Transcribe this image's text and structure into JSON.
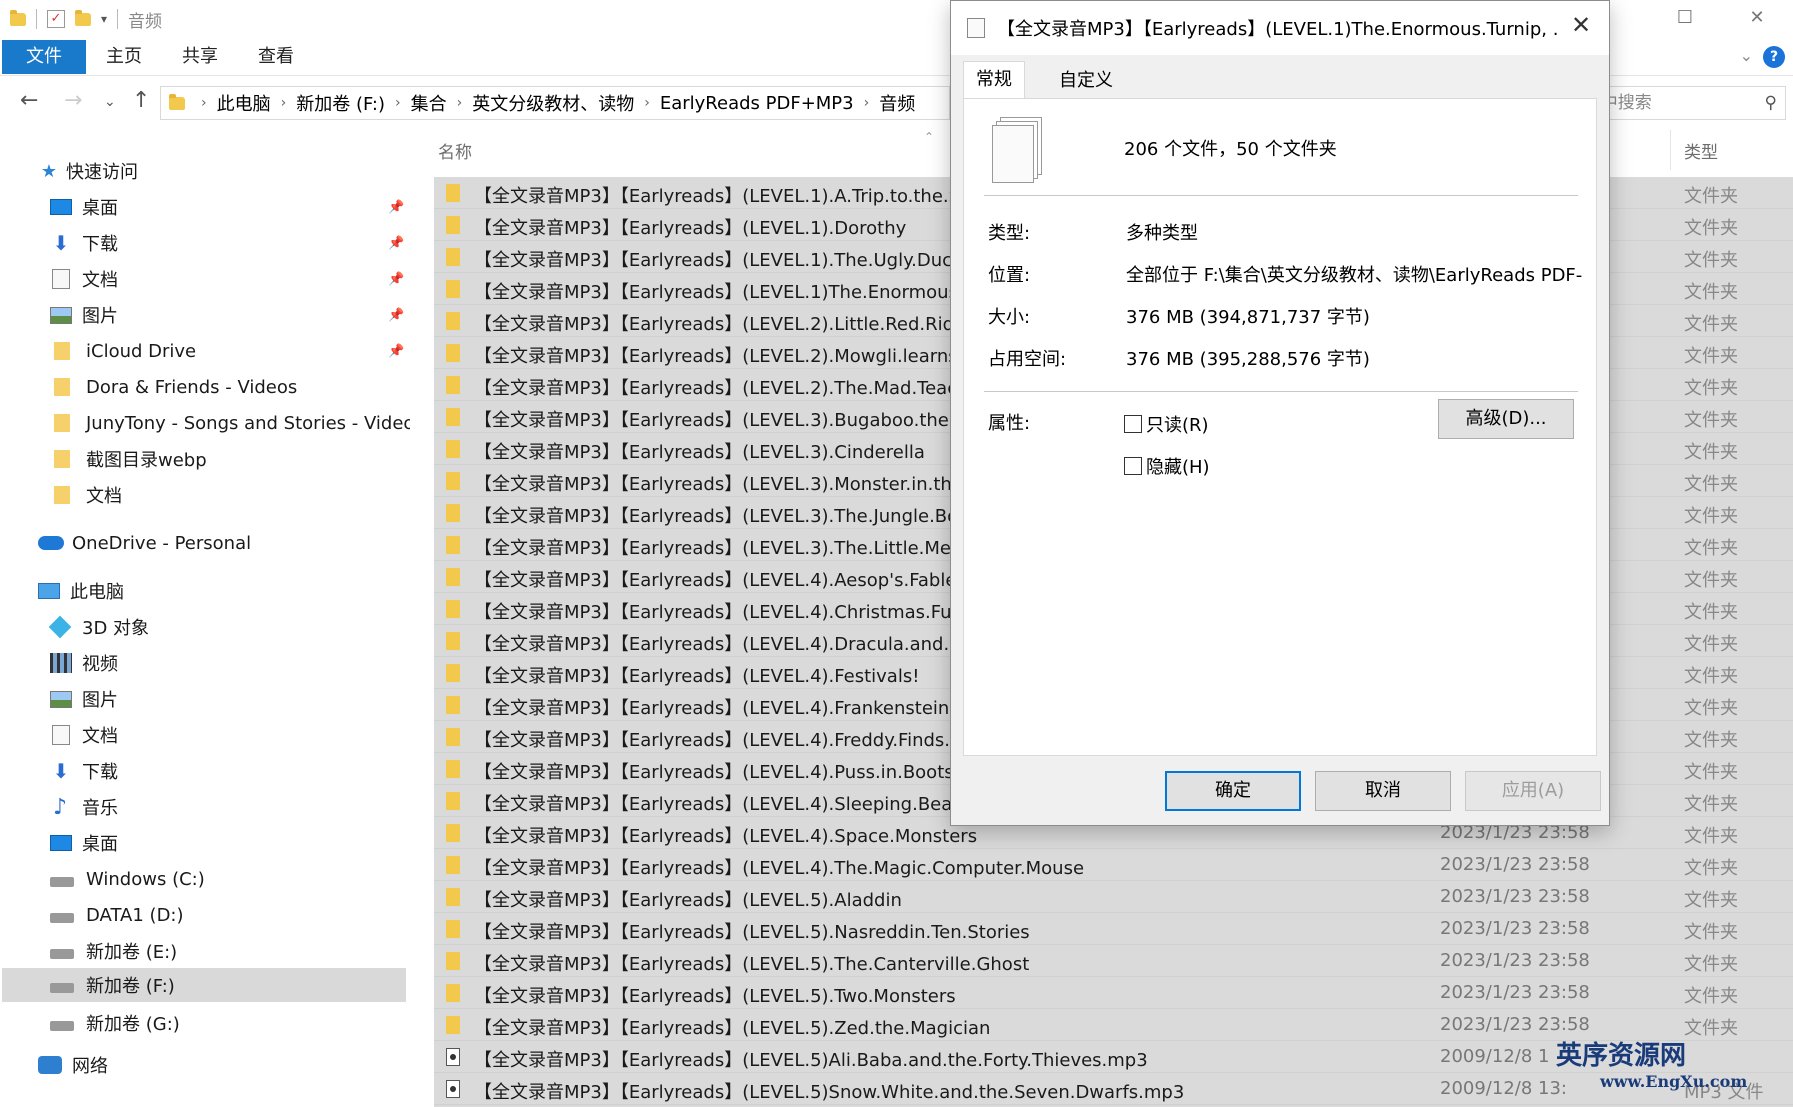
{
  "titlebar": {
    "title": "音频"
  },
  "ribbon": {
    "tabs": [
      "文件",
      "主页",
      "共享",
      "查看"
    ],
    "help": "?"
  },
  "address": {
    "crumbs": [
      "此电脑",
      "新加卷 (F:)",
      "集合",
      "英文分级教材、读物",
      "EarlyReads PDF+MP3",
      "音频"
    ],
    "search_placeholder": "在 音频 中搜索"
  },
  "nav": {
    "quick_access": "快速访问",
    "items": [
      {
        "label": "桌面"
      },
      {
        "label": "下载"
      },
      {
        "label": "文档"
      },
      {
        "label": "图片"
      },
      {
        "label": "iCloud Drive"
      },
      {
        "label": "Dora & Friends - Videos"
      },
      {
        "label": "JunyTony - Songs and Stories - Videos"
      },
      {
        "label": "截图目录webp"
      },
      {
        "label": "文档"
      }
    ],
    "onedrive": "OneDrive - Personal",
    "this_pc": "此电脑",
    "pc_items": [
      {
        "label": "3D 对象"
      },
      {
        "label": "视频"
      },
      {
        "label": "图片"
      },
      {
        "label": "文档"
      },
      {
        "label": "下载"
      },
      {
        "label": "音乐"
      },
      {
        "label": "桌面"
      },
      {
        "label": "Windows (C:)"
      },
      {
        "label": "DATA1 (D:)"
      },
      {
        "label": "新加卷 (E:)"
      },
      {
        "label": "新加卷 (F:)"
      },
      {
        "label": "新加卷 (G:)"
      }
    ],
    "network": "网络"
  },
  "list": {
    "header_name": "名称",
    "header_type": "类型",
    "rows": [
      {
        "name": "【全文录音MP3】【Earlyreads】(LEVEL.1).A.Trip.to.the.Sa",
        "date": "",
        "type": "文件夹",
        "kind": "folder"
      },
      {
        "name": "【全文录音MP3】【Earlyreads】(LEVEL.1).Dorothy",
        "date": "",
        "type": "文件夹",
        "kind": "folder"
      },
      {
        "name": "【全文录音MP3】【Earlyreads】(LEVEL.1).The.Ugly.Duckl",
        "date": "",
        "type": "文件夹",
        "kind": "folder"
      },
      {
        "name": "【全文录音MP3】【Earlyreads】(LEVEL.1)The.Enormous.T",
        "date": "",
        "type": "文件夹",
        "kind": "folder"
      },
      {
        "name": "【全文录音MP3】【Earlyreads】(LEVEL.2).Little.Red.Ridin",
        "date": "",
        "type": "文件夹",
        "kind": "folder"
      },
      {
        "name": "【全文录音MP3】【Earlyreads】(LEVEL.2).Mowgli.learns.t",
        "date": "",
        "type": "文件夹",
        "kind": "folder"
      },
      {
        "name": "【全文录音MP3】【Earlyreads】(LEVEL.2).The.Mad.Teach",
        "date": "",
        "type": "文件夹",
        "kind": "folder"
      },
      {
        "name": "【全文录音MP3】【Earlyreads】(LEVEL.3).Bugaboo.the.W",
        "date": "",
        "type": "文件夹",
        "kind": "folder"
      },
      {
        "name": "【全文录音MP3】【Earlyreads】(LEVEL.3).Cinderella",
        "date": "",
        "type": "文件夹",
        "kind": "folder"
      },
      {
        "name": "【全文录音MP3】【Earlyreads】(LEVEL.3).Monster.in.the.",
        "date": "",
        "type": "文件夹",
        "kind": "folder"
      },
      {
        "name": "【全文录音MP3】【Earlyreads】(LEVEL.3).The.Jungle.Boo",
        "date": "",
        "type": "文件夹",
        "kind": "folder"
      },
      {
        "name": "【全文录音MP3】【Earlyreads】(LEVEL.3).The.Little.Merm",
        "date": "",
        "type": "文件夹",
        "kind": "folder"
      },
      {
        "name": "【全文录音MP3】【Earlyreads】(LEVEL.4).Aesop's.Fables",
        "date": "",
        "type": "文件夹",
        "kind": "folder"
      },
      {
        "name": "【全文录音MP3】【Earlyreads】(LEVEL.4).Christmas.Fun",
        "date": "",
        "type": "文件夹",
        "kind": "folder"
      },
      {
        "name": "【全文录音MP3】【Earlyreads】(LEVEL.4).Dracula.and.His",
        "date": "",
        "type": "文件夹",
        "kind": "folder"
      },
      {
        "name": "【全文录音MP3】【Earlyreads】(LEVEL.4).Festivals!",
        "date": "",
        "type": "文件夹",
        "kind": "folder"
      },
      {
        "name": "【全文录音MP3】【Earlyreads】(LEVEL.4).Frankenstein.at",
        "date": "",
        "type": "文件夹",
        "kind": "folder"
      },
      {
        "name": "【全文录音MP3】【Earlyreads】(LEVEL.4).Freddy.Finds.th",
        "date": "",
        "type": "文件夹",
        "kind": "folder"
      },
      {
        "name": "【全文录音MP3】【Earlyreads】(LEVEL.4).Puss.in.Boots",
        "date": "",
        "type": "文件夹",
        "kind": "folder"
      },
      {
        "name": "【全文录音MP3】【Earlyreads】(LEVEL.4).Sleeping.Beaut",
        "date": "",
        "type": "文件夹",
        "kind": "folder"
      },
      {
        "name": "【全文录音MP3】【Earlyreads】(LEVEL.4).Space.Monsters",
        "date": "2023/1/23 23:58",
        "type": "文件夹",
        "kind": "folder"
      },
      {
        "name": "【全文录音MP3】【Earlyreads】(LEVEL.4).The.Magic.Computer.Mouse",
        "date": "2023/1/23 23:58",
        "type": "文件夹",
        "kind": "folder"
      },
      {
        "name": "【全文录音MP3】【Earlyreads】(LEVEL.5).Aladdin",
        "date": "2023/1/23 23:58",
        "type": "文件夹",
        "kind": "folder"
      },
      {
        "name": "【全文录音MP3】【Earlyreads】(LEVEL.5).Nasreddin.Ten.Stories",
        "date": "2023/1/23 23:58",
        "type": "文件夹",
        "kind": "folder"
      },
      {
        "name": "【全文录音MP3】【Earlyreads】(LEVEL.5).The.Canterville.Ghost",
        "date": "2023/1/23 23:58",
        "type": "文件夹",
        "kind": "folder"
      },
      {
        "name": "【全文录音MP3】【Earlyreads】(LEVEL.5).Two.Monsters",
        "date": "2023/1/23 23:58",
        "type": "文件夹",
        "kind": "folder"
      },
      {
        "name": "【全文录音MP3】【Earlyreads】(LEVEL.5).Zed.the.Magician",
        "date": "2023/1/23 23:58",
        "type": "文件夹",
        "kind": "folder"
      },
      {
        "name": "【全文录音MP3】【Earlyreads】(LEVEL.5)Ali.Baba.and.the.Forty.Thieves.mp3",
        "date": "2009/12/8 1",
        "type": "",
        "kind": "mp3"
      },
      {
        "name": "【全文录音MP3】【Earlyreads】(LEVEL.5)Snow.White.and.the.Seven.Dwarfs.mp3",
        "date": "2009/12/8 13:",
        "type": "MP3 文件",
        "kind": "mp3"
      }
    ]
  },
  "dialog": {
    "title": "【全文录音MP3】【Earlyreads】(LEVEL.1)The.Enormous.Turnip, ......",
    "tabs": [
      "常规",
      "自定义"
    ],
    "summary": "206 个文件，50 个文件夹",
    "fields": [
      {
        "label": "类型:",
        "value": "多种类型"
      },
      {
        "label": "位置:",
        "value": "全部位于 F:\\集合\\英文分级教材、读物\\EarlyReads PDF-"
      },
      {
        "label": "大小:",
        "value": "376 MB (394,871,737 字节)"
      },
      {
        "label": "占用空间:",
        "value": "376 MB (395,288,576 字节)"
      }
    ],
    "attributes_label": "属性:",
    "readonly_label": "只读(R)",
    "hidden_label": "隐藏(H)",
    "advanced_label": "高级(D)...",
    "ok_label": "确定",
    "cancel_label": "取消",
    "apply_label": "应用(A)"
  },
  "watermark": {
    "line1": "英序资源网",
    "line2": "www.EngXu.com"
  }
}
